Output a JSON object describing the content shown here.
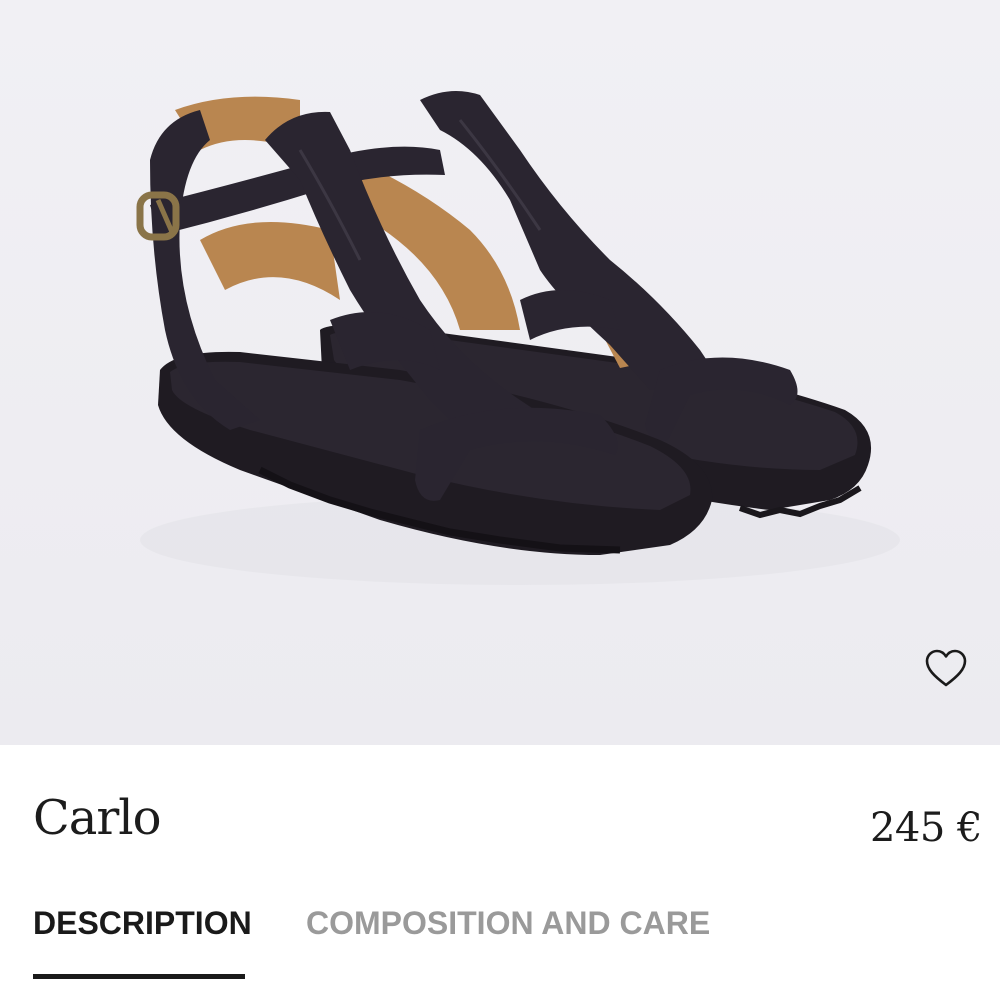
{
  "product": {
    "name": "Carlo",
    "price": "245 €",
    "image_alt": "Black leather gladiator sandals with tan lining and brass buckle"
  },
  "wishlist": {
    "icon": "heart-outline-icon"
  },
  "tabs": [
    {
      "label": "DESCRIPTION",
      "active": true
    },
    {
      "label": "COMPOSITION AND CARE",
      "active": false
    }
  ],
  "colors": {
    "background": "#ffffff",
    "image_background": "#efeef3",
    "text_primary": "#1a1a1a",
    "tab_inactive": "#9a9a9a",
    "sandal_leather": "#2a2530",
    "sandal_lining": "#b98650",
    "buckle": "#8a7448"
  }
}
